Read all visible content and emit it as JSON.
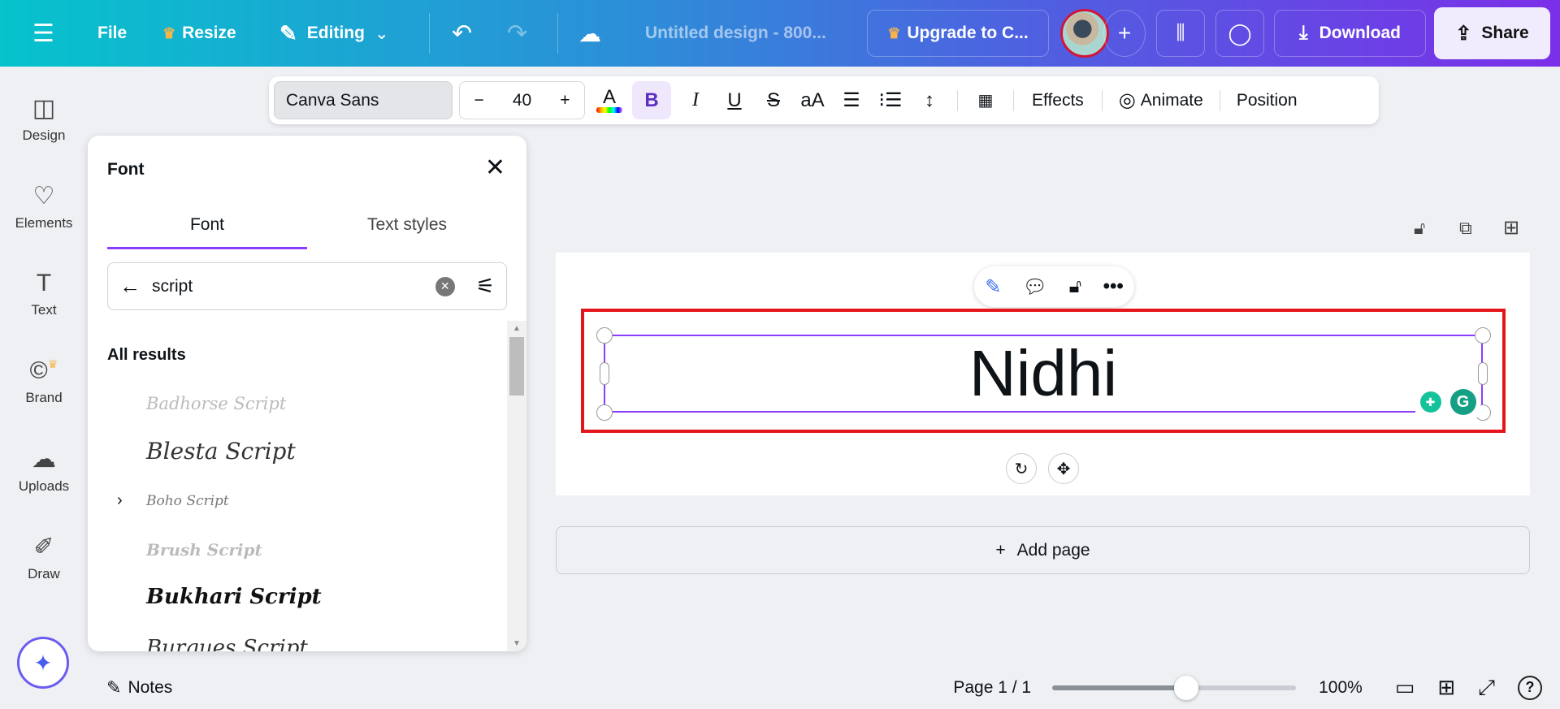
{
  "topbar": {
    "file": "File",
    "resize": "Resize",
    "editing": "Editing",
    "title": "Untitled design - 800...",
    "upgrade": "Upgrade to C...",
    "download": "Download",
    "share": "Share"
  },
  "toolbar": {
    "font": "Canva Sans",
    "size": "40",
    "minus": "−",
    "plus": "+",
    "color_letter": "A",
    "bold": "B",
    "italic": "I",
    "underline": "U",
    "strike": "S",
    "case": "aA",
    "effects": "Effects",
    "animate": "Animate",
    "position": "Position"
  },
  "sidebar": {
    "items": [
      {
        "label": "Design"
      },
      {
        "label": "Elements"
      },
      {
        "label": "Text"
      },
      {
        "label": "Brand"
      },
      {
        "label": "Uploads"
      },
      {
        "label": "Draw"
      }
    ]
  },
  "panel": {
    "title": "Font",
    "tabs": [
      "Font",
      "Text styles"
    ],
    "search_value": "script",
    "section": "All results",
    "fonts": [
      "Badhorse Script",
      "Blesta Script",
      "Boho Script",
      "Brush Script",
      "Bukhari Script",
      "Burgues Script"
    ]
  },
  "canvas": {
    "text": "Nidhi",
    "add_page": "Add page"
  },
  "bottom": {
    "notes": "Notes",
    "page": "Page 1 / 1",
    "zoom": "100%",
    "zoom_fraction": 0.55
  }
}
